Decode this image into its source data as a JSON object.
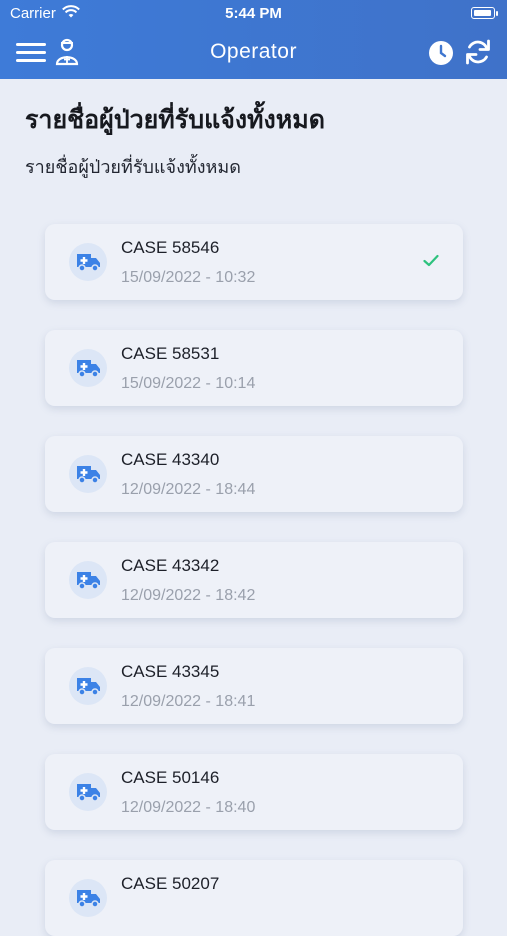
{
  "status_bar": {
    "carrier": "Carrier",
    "time": "5:44 PM"
  },
  "nav": {
    "title": "Operator",
    "icons": [
      "menu-icon",
      "operator-profile-icon",
      "history-clock-icon",
      "refresh-icon"
    ]
  },
  "page": {
    "title": "รายชื่อผู้ป่วยที่รับแจ้งทั้งหมด",
    "subtitle": "รายชื่อผู้ป่วยที่รับแจ้งทั้งหมด"
  },
  "colors": {
    "header": "#3e7bd8",
    "background": "#e9edf6",
    "card": "#eef1f8",
    "icon_blue": "#3c82e6",
    "check_green": "#2ec27e"
  },
  "cases": [
    {
      "title": "CASE 58546",
      "datetime": "15/09/2022 - 10:32",
      "checked": true
    },
    {
      "title": "CASE 58531",
      "datetime": "15/09/2022 - 10:14",
      "checked": false
    },
    {
      "title": "CASE 43340",
      "datetime": "12/09/2022 - 18:44",
      "checked": false
    },
    {
      "title": "CASE 43342",
      "datetime": "12/09/2022 - 18:42",
      "checked": false
    },
    {
      "title": "CASE 43345",
      "datetime": "12/09/2022 - 18:41",
      "checked": false
    },
    {
      "title": "CASE 50146",
      "datetime": "12/09/2022 - 18:40",
      "checked": false
    },
    {
      "title": "CASE 50207",
      "datetime": "",
      "checked": false
    }
  ]
}
